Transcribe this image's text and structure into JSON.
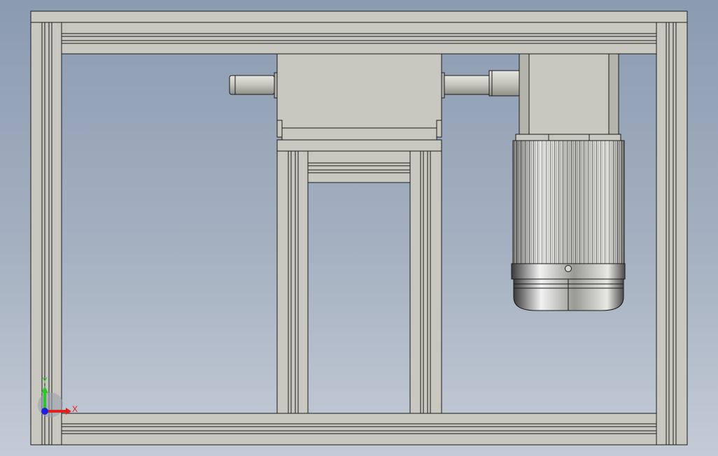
{
  "viewport": {
    "background_top": "#8b9bb0",
    "background_bottom": "#c4cbd6",
    "part_fill": "#c8c8c0",
    "edge_color": "#1a1a1a"
  },
  "triad": {
    "x_label": "X",
    "y_label": "Y",
    "x_color": "#e0201b",
    "y_color": "#2fc32f",
    "z_color": "#1f1fe0"
  }
}
